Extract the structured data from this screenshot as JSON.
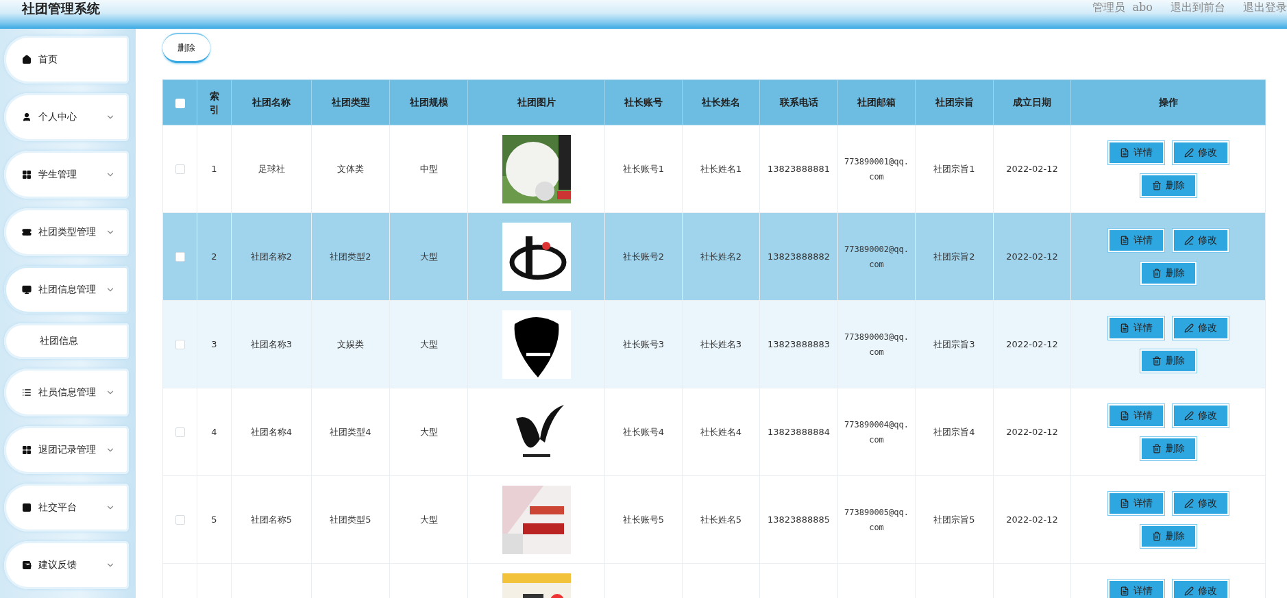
{
  "header": {
    "title": "社团管理系统",
    "user_role": "管理员",
    "user_name": "abo",
    "links": [
      "退出到前台",
      "退出登录"
    ]
  },
  "sidebar": {
    "items": [
      {
        "label": "首页",
        "has_submenu": false
      },
      {
        "label": "个人中心",
        "has_submenu": true
      },
      {
        "label": "学生管理",
        "has_submenu": true
      },
      {
        "label": "社团类型管理",
        "has_submenu": true
      },
      {
        "label": "社团信息管理",
        "has_submenu": true,
        "expanded": true,
        "children": [
          {
            "label": "社团信息"
          }
        ]
      },
      {
        "label": "社员信息管理",
        "has_submenu": true
      },
      {
        "label": "退团记录管理",
        "has_submenu": true
      },
      {
        "label": "社交平台",
        "has_submenu": true
      },
      {
        "label": "建议反馈",
        "has_submenu": true
      }
    ]
  },
  "toolbar": {
    "delete_button": "删除"
  },
  "table": {
    "all_checked": false,
    "columns": [
      "索引",
      "社团名称",
      "社团类型",
      "社团规模",
      "社团图片",
      "社长账号",
      "社长姓名",
      "联系电话",
      "社团邮箱",
      "社团宗旨",
      "成立日期",
      "操作"
    ],
    "rows": [
      {
        "checked": false,
        "selected": false,
        "highlighted": false,
        "cells": [
          "1",
          "足球社",
          "文体类",
          "中型",
          {
            "kind": "picture"
          },
          "社长账号1",
          "社长姓名1",
          "13823888881",
          "773890001@qq.com",
          "社团宗旨1",
          "2022-02-12"
        ],
        "actions": [
          "详情",
          "修改",
          "删除"
        ]
      },
      {
        "checked": false,
        "selected": true,
        "highlighted": false,
        "cells": [
          "2",
          "社团名称2",
          "社团类型2",
          "大型",
          {
            "kind": "picture"
          },
          "社长账号2",
          "社长姓名2",
          "13823888882",
          "773890002@qq.com",
          "社团宗旨2",
          "2022-02-12"
        ],
        "actions": [
          "详情",
          "修改",
          "删除"
        ]
      },
      {
        "checked": false,
        "selected": false,
        "highlighted": true,
        "cells": [
          "3",
          "社团名称3",
          "文娱类",
          "大型",
          {
            "kind": "picture"
          },
          "社长账号3",
          "社长姓名3",
          "13823888883",
          "773890003@qq.com",
          "社团宗旨3",
          "2022-02-12"
        ],
        "actions": [
          "详情",
          "修改",
          "删除"
        ]
      },
      {
        "checked": false,
        "selected": false,
        "highlighted": false,
        "cells": [
          "4",
          "社团名称4",
          "社团类型4",
          "大型",
          {
            "kind": "picture"
          },
          "社长账号4",
          "社长姓名4",
          "13823888884",
          "773890004@qq.com",
          "社团宗旨4",
          "2022-02-12"
        ],
        "actions": [
          "详情",
          "修改",
          "删除"
        ]
      },
      {
        "checked": false,
        "selected": false,
        "highlighted": false,
        "cells": [
          "5",
          "社团名称5",
          "社团类型5",
          "大型",
          {
            "kind": "picture"
          },
          "社长账号5",
          "社长姓名5",
          "13823888885",
          "773890005@qq.com",
          "社团宗旨5",
          "2022-02-12"
        ],
        "actions": [
          "详情",
          "修改",
          "删除"
        ]
      },
      {
        "selected": false,
        "highlighted": false,
        "cells": [
          "",
          "",
          "",
          "",
          {
            "kind": "picture"
          },
          "",
          "",
          "",
          "",
          "",
          ""
        ],
        "actions": [
          "详情",
          "修改"
        ]
      }
    ]
  }
}
